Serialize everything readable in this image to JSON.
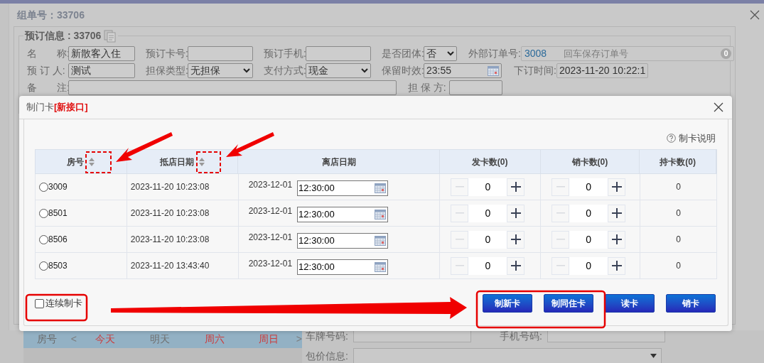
{
  "background": {
    "schedule": {
      "room_label": "房号",
      "prev": "<",
      "next": ">",
      "days": [
        {
          "label": "今天",
          "highlight": true
        },
        {
          "label": "明天",
          "highlight": false
        },
        {
          "label": "周六",
          "highlight": true
        },
        {
          "label": "周日",
          "highlight": true
        }
      ]
    },
    "fields": [
      {
        "label": "车牌号码:"
      },
      {
        "label": "手机号码:"
      },
      {
        "label": "包价信息:",
        "kind": "select"
      }
    ]
  },
  "order_dialog": {
    "title": "组单号：33706",
    "section_title": "预订信息 : 33706",
    "rows": [
      [
        {
          "label": "名　　称:",
          "kind": "text",
          "value": "新散客入住"
        },
        {
          "label": "预订卡号:",
          "kind": "text"
        },
        {
          "label": "预订手机:",
          "kind": "text"
        },
        {
          "label": "是否团体:",
          "kind": "select",
          "value": "否"
        },
        {
          "label": "外部订单号:",
          "kind": "order",
          "value": "3008",
          "placeholder": "回车保存订单号",
          "badge": "0"
        }
      ],
      [
        {
          "label": "预 订 人:",
          "kind": "text",
          "value": "测试"
        },
        {
          "label": "担保类型:",
          "kind": "select",
          "value": "无担保"
        },
        {
          "label": "支付方式:",
          "kind": "select",
          "value": "现金"
        },
        {
          "label": "保留时效:",
          "kind": "time",
          "value": "23:55"
        },
        {
          "label": "下订时间:",
          "kind": "readonly",
          "value": "2023-11-20 10:22:1"
        }
      ]
    ],
    "remark": {
      "label": "备　　注:",
      "kind": "text"
    },
    "guarantor": {
      "label": "担 保 方:",
      "kind": "text"
    }
  },
  "card_dialog": {
    "title": "制门卡",
    "title_tag": "[新接口]",
    "help": "制卡说明",
    "columns": [
      {
        "label": "房号",
        "sortable": true
      },
      {
        "label": "抵店日期",
        "sortable": true
      },
      {
        "label": "离店日期",
        "sortable": false
      },
      {
        "label": "发卡数(0)",
        "sortable": false
      },
      {
        "label": "销卡数(0)",
        "sortable": false
      },
      {
        "label": "持卡数(0)",
        "sortable": false
      }
    ],
    "rows": [
      {
        "room": "3009",
        "selected": false,
        "arrival": "2023-11-20 10:23:08",
        "departure_date": "2023-12-01",
        "departure_time": "12:30:00",
        "issued": "0",
        "cancelled": "0",
        "held": "0"
      },
      {
        "room": "8501",
        "selected": false,
        "arrival": "2023-11-20 10:23:08",
        "departure_date": "2023-12-01",
        "departure_time": "12:30:00",
        "issued": "0",
        "cancelled": "0",
        "held": "0"
      },
      {
        "room": "8506",
        "selected": false,
        "arrival": "2023-11-20 10:23:08",
        "departure_date": "2023-12-01",
        "departure_time": "12:30:00",
        "issued": "0",
        "cancelled": "0",
        "held": "0"
      },
      {
        "room": "8503",
        "selected": false,
        "arrival": "2023-11-20 13:43:40",
        "departure_date": "2023-12-01",
        "departure_time": "12:30:00",
        "issued": "0",
        "cancelled": "0",
        "held": "0"
      }
    ],
    "continuous": {
      "label": "连续制卡",
      "checked": false
    },
    "buttons": [
      "制新卡",
      "制同住卡",
      "读卡",
      "销卡"
    ]
  }
}
